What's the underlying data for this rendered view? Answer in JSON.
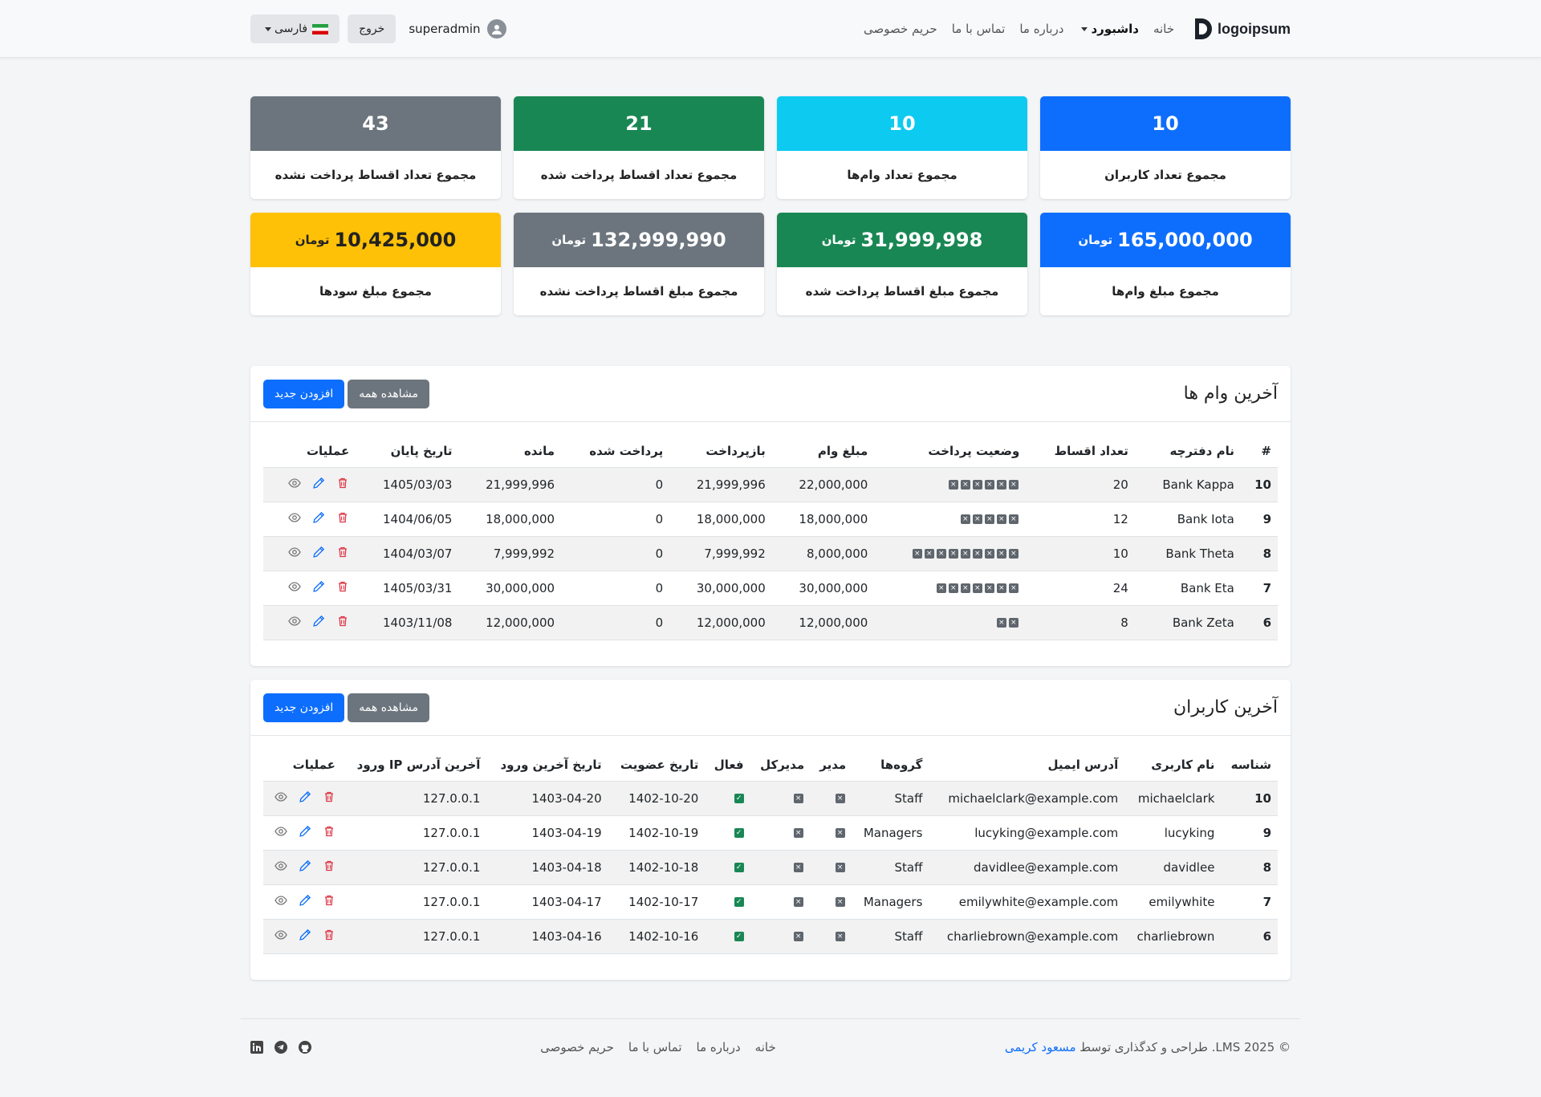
{
  "nav": {
    "logo_text": "logoipsum",
    "links": [
      "خانه",
      "داشبورد",
      "درباره ما",
      "تماس با ما",
      "حریم خصوصی"
    ],
    "user": "superadmin",
    "logout": "خروج",
    "language": "فارسی"
  },
  "stats": [
    {
      "value": "10",
      "label": "مجموع تعداد کاربران",
      "color": "#0d6efd"
    },
    {
      "value": "10",
      "label": "مجموع تعداد وام‌ها",
      "color": "#0dcaf0"
    },
    {
      "value": "21",
      "label": "مجموع تعداد اقساط پرداخت شده",
      "color": "#198754"
    },
    {
      "value": "43",
      "label": "مجموع تعداد اقساط پرداخت نشده",
      "color": "#6c757d"
    },
    {
      "value": "165,000,000",
      "unit": "تومان",
      "label": "مجموع مبلغ وام‌ها",
      "color": "#0d6efd"
    },
    {
      "value": "31,999,998",
      "unit": "تومان",
      "label": "مجموع مبلغ اقساط پرداخت شده",
      "color": "#198754"
    },
    {
      "value": "132,999,990",
      "unit": "تومان",
      "label": "مجموع مبلغ اقساط پرداخت نشده",
      "color": "#6c757d"
    },
    {
      "value": "10,425,000",
      "unit": "تومان",
      "label": "مجموع مبلغ سودها",
      "color": "#ffc107"
    }
  ],
  "loans": {
    "title": "آخرین وام ها",
    "view_all": "مشاهده همه",
    "add_new": "افزودن جدید",
    "headers": [
      "#",
      "نام دفترچه",
      "تعداد اقساط",
      "وضعیت پرداخت",
      "مبلغ وام",
      "بازپرداخت",
      "پرداخت شده",
      "مانده",
      "تاریخ پایان",
      "عملیات"
    ],
    "rows": [
      {
        "id": "10",
        "name": "Bank Kappa",
        "installments": "20",
        "status_count": 6,
        "amount": "22,000,000",
        "repay": "21,999,996",
        "paid": "0",
        "remain": "21,999,996",
        "end": "1405/03/03"
      },
      {
        "id": "9",
        "name": "Bank Iota",
        "installments": "12",
        "status_count": 5,
        "amount": "18,000,000",
        "repay": "18,000,000",
        "paid": "0",
        "remain": "18,000,000",
        "end": "1404/06/05"
      },
      {
        "id": "8",
        "name": "Bank Theta",
        "installments": "10",
        "status_count": 9,
        "amount": "8,000,000",
        "repay": "7,999,992",
        "paid": "0",
        "remain": "7,999,992",
        "end": "1404/03/07"
      },
      {
        "id": "7",
        "name": "Bank Eta",
        "installments": "24",
        "status_count": 7,
        "amount": "30,000,000",
        "repay": "30,000,000",
        "paid": "0",
        "remain": "30,000,000",
        "end": "1405/03/31"
      },
      {
        "id": "6",
        "name": "Bank Zeta",
        "installments": "8",
        "status_count": 2,
        "amount": "12,000,000",
        "repay": "12,000,000",
        "paid": "0",
        "remain": "12,000,000",
        "end": "1403/11/08"
      }
    ]
  },
  "users": {
    "title": "آخرین کاربران",
    "view_all": "مشاهده همه",
    "add_new": "افزودن جدید",
    "headers": [
      "شناسه",
      "نام کاربری",
      "آدرس ایمیل",
      "گروه‌ها",
      "مدیر",
      "مدیرکل",
      "فعال",
      "تاریخ عضویت",
      "تاریخ آخرین ورود",
      "آخرین آدرس IP ورود",
      "عملیات"
    ],
    "rows": [
      {
        "id": "10",
        "username": "michaelclark",
        "email": "michaelclark@example.com",
        "group": "Staff",
        "joined": "1402-10-20",
        "last_login": "1403-04-20",
        "ip": "127.0.0.1"
      },
      {
        "id": "9",
        "username": "lucyking",
        "email": "lucyking@example.com",
        "group": "Managers",
        "joined": "1402-10-19",
        "last_login": "1403-04-19",
        "ip": "127.0.0.1"
      },
      {
        "id": "8",
        "username": "davidlee",
        "email": "davidlee@example.com",
        "group": "Staff",
        "joined": "1402-10-18",
        "last_login": "1403-04-18",
        "ip": "127.0.0.1"
      },
      {
        "id": "7",
        "username": "emilywhite",
        "email": "emilywhite@example.com",
        "group": "Managers",
        "joined": "1402-10-17",
        "last_login": "1403-04-17",
        "ip": "127.0.0.1"
      },
      {
        "id": "6",
        "username": "charliebrown",
        "email": "charliebrown@example.com",
        "group": "Staff",
        "joined": "1402-10-16",
        "last_login": "1403-04-16",
        "ip": "127.0.0.1"
      }
    ]
  },
  "footer": {
    "copyright": "© 2025 LMS. طراحی و کدگذاری توسط",
    "author": "مسعود کریمی",
    "links": [
      "خانه",
      "درباره ما",
      "تماس با ما",
      "حریم خصوصی"
    ]
  },
  "icons": {
    "eye": "eye-icon",
    "edit": "pencil-icon",
    "delete": "trash-icon",
    "linkedin": "linkedin-icon",
    "telegram": "telegram-icon",
    "github": "github-icon"
  }
}
